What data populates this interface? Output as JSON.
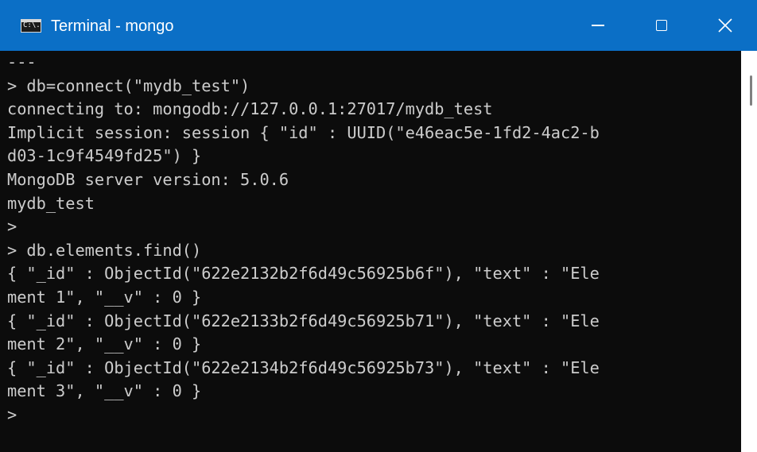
{
  "window": {
    "title": "Terminal - mongo",
    "icon_text": "C:\\."
  },
  "controls": {
    "minimize": "minimize-icon",
    "maximize": "maximize-icon",
    "close": "close-icon",
    "close_glyph": "✕"
  },
  "terminal": {
    "lines": [
      "---",
      "> db=connect(\"mydb_test\")",
      "connecting to: mongodb://127.0.0.1:27017/mydb_test",
      "Implicit session: session { \"id\" : UUID(\"e46eac5e-1fd2-4ac2-b",
      "d03-1c9f4549fd25\") }",
      "MongoDB server version: 5.0.6",
      "mydb_test",
      ">",
      "> db.elements.find()",
      "{ \"_id\" : ObjectId(\"622e2132b2f6d49c56925b6f\"), \"text\" : \"Ele",
      "ment 1\", \"__v\" : 0 }",
      "{ \"_id\" : ObjectId(\"622e2133b2f6d49c56925b71\"), \"text\" : \"Ele",
      "ment 2\", \"__v\" : 0 }",
      "{ \"_id\" : ObjectId(\"622e2134b2f6d49c56925b73\"), \"text\" : \"Ele",
      "ment 3\", \"__v\" : 0 }",
      ">"
    ]
  },
  "colors": {
    "titlebar": "#0b6fc6",
    "terminal_bg": "#0c0c0c",
    "terminal_fg": "#cccccc"
  }
}
